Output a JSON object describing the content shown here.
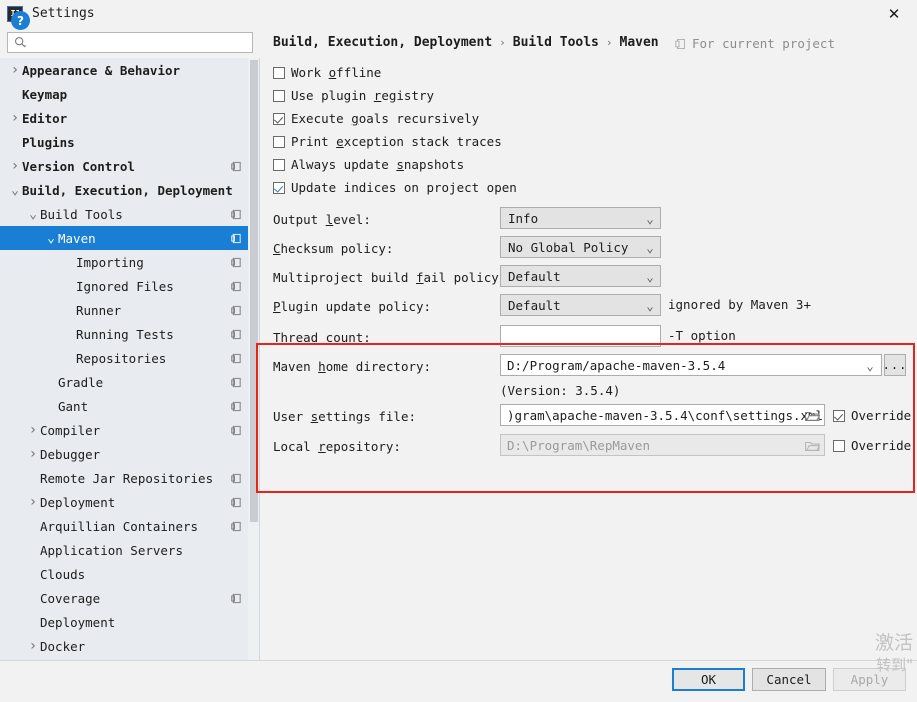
{
  "window": {
    "title": "Settings",
    "app_icon": "IJ",
    "close_icon": "✕"
  },
  "search": {
    "value": "",
    "placeholder": "",
    "icon": "search-icon"
  },
  "sidebar": {
    "items": [
      {
        "label": "Appearance & Behavior",
        "indent": 0,
        "chevron": "collapsed",
        "bold": true,
        "project_icon": false,
        "selected": false
      },
      {
        "label": "Keymap",
        "indent": 0,
        "chevron": "none",
        "bold": true,
        "project_icon": false,
        "selected": false
      },
      {
        "label": "Editor",
        "indent": 0,
        "chevron": "collapsed",
        "bold": true,
        "project_icon": false,
        "selected": false
      },
      {
        "label": "Plugins",
        "indent": 0,
        "chevron": "none",
        "bold": true,
        "project_icon": false,
        "selected": false
      },
      {
        "label": "Version Control",
        "indent": 0,
        "chevron": "collapsed",
        "bold": true,
        "project_icon": true,
        "selected": false
      },
      {
        "label": "Build, Execution, Deployment",
        "indent": 0,
        "chevron": "expanded",
        "bold": true,
        "project_icon": false,
        "selected": false
      },
      {
        "label": "Build Tools",
        "indent": 1,
        "chevron": "expanded",
        "bold": false,
        "project_icon": true,
        "selected": false
      },
      {
        "label": "Maven",
        "indent": 2,
        "chevron": "expanded",
        "bold": false,
        "project_icon": true,
        "selected": true
      },
      {
        "label": "Importing",
        "indent": 3,
        "chevron": "none",
        "bold": false,
        "project_icon": true,
        "selected": false
      },
      {
        "label": "Ignored Files",
        "indent": 3,
        "chevron": "none",
        "bold": false,
        "project_icon": true,
        "selected": false
      },
      {
        "label": "Runner",
        "indent": 3,
        "chevron": "none",
        "bold": false,
        "project_icon": true,
        "selected": false
      },
      {
        "label": "Running Tests",
        "indent": 3,
        "chevron": "none",
        "bold": false,
        "project_icon": true,
        "selected": false
      },
      {
        "label": "Repositories",
        "indent": 3,
        "chevron": "none",
        "bold": false,
        "project_icon": true,
        "selected": false
      },
      {
        "label": "Gradle",
        "indent": 2,
        "chevron": "none",
        "bold": false,
        "project_icon": true,
        "selected": false
      },
      {
        "label": "Gant",
        "indent": 2,
        "chevron": "none",
        "bold": false,
        "project_icon": true,
        "selected": false
      },
      {
        "label": "Compiler",
        "indent": 1,
        "chevron": "collapsed",
        "bold": false,
        "project_icon": true,
        "selected": false
      },
      {
        "label": "Debugger",
        "indent": 1,
        "chevron": "collapsed",
        "bold": false,
        "project_icon": false,
        "selected": false
      },
      {
        "label": "Remote Jar Repositories",
        "indent": 1,
        "chevron": "none",
        "bold": false,
        "project_icon": true,
        "selected": false
      },
      {
        "label": "Deployment",
        "indent": 1,
        "chevron": "collapsed",
        "bold": false,
        "project_icon": true,
        "selected": false
      },
      {
        "label": "Arquillian Containers",
        "indent": 1,
        "chevron": "none",
        "bold": false,
        "project_icon": true,
        "selected": false
      },
      {
        "label": "Application Servers",
        "indent": 1,
        "chevron": "none",
        "bold": false,
        "project_icon": false,
        "selected": false
      },
      {
        "label": "Clouds",
        "indent": 1,
        "chevron": "none",
        "bold": false,
        "project_icon": false,
        "selected": false
      },
      {
        "label": "Coverage",
        "indent": 1,
        "chevron": "none",
        "bold": false,
        "project_icon": true,
        "selected": false
      },
      {
        "label": "Deployment",
        "indent": 1,
        "chevron": "none",
        "bold": false,
        "project_icon": false,
        "selected": false
      },
      {
        "label": "Docker",
        "indent": 1,
        "chevron": "collapsed",
        "bold": false,
        "project_icon": false,
        "selected": false
      }
    ]
  },
  "main": {
    "breadcrumb": [
      "Build, Execution, Deployment",
      "Build Tools",
      "Maven"
    ],
    "breadcrumb_separator": "›",
    "scope_note": "For current project",
    "checkboxes": [
      {
        "pre": "Work ",
        "mnemonic": "o",
        "post": "ffline",
        "state": "unchecked"
      },
      {
        "pre": "Use plugin ",
        "mnemonic": "r",
        "post": "egistry",
        "state": "unchecked"
      },
      {
        "pre": "Execute ",
        "mnemonic": "g",
        "post": "oals recursively",
        "state": "checked-dark"
      },
      {
        "pre": "Print ",
        "mnemonic": "e",
        "post": "xception stack traces",
        "state": "unchecked"
      },
      {
        "pre": "Always update ",
        "mnemonic": "s",
        "post": "napshots",
        "state": "unchecked"
      },
      {
        "pre": "Update indices on project open",
        "mnemonic": "",
        "post": "",
        "state": "checked-blue"
      }
    ],
    "combos": [
      {
        "pre": "Output ",
        "mnemonic": "l",
        "post": "evel:",
        "value": "Info",
        "hint": ""
      },
      {
        "pre": "",
        "mnemonic": "C",
        "post": "hecksum policy:",
        "value": "No Global Policy",
        "hint": ""
      },
      {
        "pre": "Multiproject build ",
        "mnemonic": "f",
        "post": "ail policy:",
        "value": "Default",
        "hint": ""
      },
      {
        "pre": "",
        "mnemonic": "P",
        "post": "lugin update policy:",
        "value": "Default",
        "hint": "ignored by Maven 3+"
      }
    ],
    "thread_count": {
      "label": "Thread count:",
      "value": "",
      "hint": "-T option"
    },
    "maven_home": {
      "pre": "Maven ",
      "mnemonic": "h",
      "post": "ome directory:",
      "value": "D:/Program/apache-maven-3.5.4",
      "browse_label": "...",
      "version_note": "(Version: 3.5.4)"
    },
    "user_settings": {
      "pre": "User ",
      "mnemonic": "s",
      "post": "ettings file:",
      "value": ")gram\\apache-maven-3.5.4\\conf\\settings.xml",
      "override_label": "Override",
      "override_checked": true,
      "folder_icon": "folder-icon"
    },
    "local_repository": {
      "pre": "Local ",
      "mnemonic": "r",
      "post": "epository:",
      "value": "D:\\Program\\RepMaven",
      "override_label": "Override",
      "override_checked": false,
      "disabled": true,
      "folder_icon": "folder-icon"
    },
    "highlight_color": "#e8241a"
  },
  "footer": {
    "help_label": "?",
    "ok_label": "OK",
    "cancel_label": "Cancel",
    "apply_label": "Apply",
    "apply_disabled": true
  },
  "watermark": {
    "line1": "激活",
    "line2": "转到\""
  },
  "colors": {
    "accent": "#1a7fd4",
    "selection": "#1a7fd4",
    "sidebar_bg": "#e8ecf0",
    "panel_bg": "#f2f2f2",
    "highlight": "#e8241a"
  }
}
